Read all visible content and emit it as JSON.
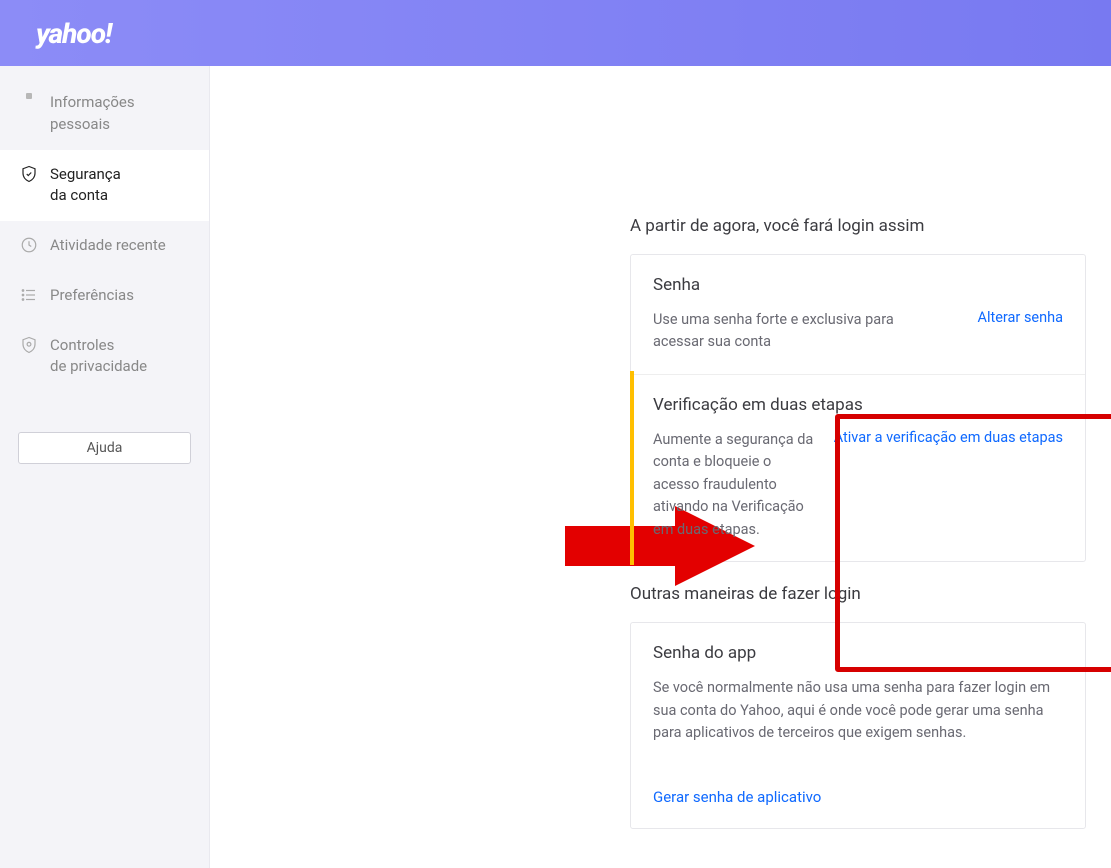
{
  "header": {
    "logo": "yahoo!"
  },
  "sidebar": {
    "items": [
      {
        "label": "Informações pessoais"
      },
      {
        "label": "Segurança\nda conta"
      },
      {
        "label": "Atividade recente"
      },
      {
        "label": "Preferências"
      },
      {
        "label": "Controles\nde privacidade"
      }
    ],
    "help_label": "Ajuda"
  },
  "main": {
    "heading1": "A partir de agora, você fará login assim",
    "password_card": {
      "title": "Senha",
      "desc": "Use uma senha forte e exclusiva para acessar sua conta",
      "link": "Alterar senha"
    },
    "twostep_card": {
      "title": "Verificação em duas etapas",
      "desc": "Aumente a segurança da conta e bloqueie o acesso fraudulento ativando na Verificação em duas etapas.",
      "link": "Ativar a verificação em duas etapas"
    },
    "heading2": "Outras maneiras de fazer login",
    "app_card": {
      "title": "Senha do app",
      "desc": "Se você normalmente não usa uma senha para fazer login em sua conta do Yahoo, aqui é onde você pode gerar uma senha para aplicativos de terceiros que exigem senhas."
    },
    "gen_link": "Gerar senha de aplicativo"
  }
}
